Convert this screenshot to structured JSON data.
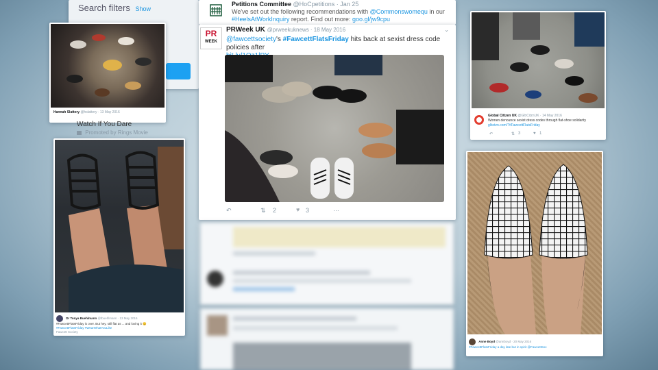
{
  "search_filters": {
    "label": "Search filters",
    "show": "Show"
  },
  "petitions_tweet": {
    "author": "Petitions Committee",
    "handle": "@HoCpetitions · Jan 25",
    "text_1": "We've set out the following recommendations with",
    "mention": "@Commonswomequ",
    "text_2": "in our",
    "hashtag": "#HeelsAtWorkInquiry",
    "text_3": "report. Find out more:",
    "link": "goo.gl/jw9cpu"
  },
  "prweek_tweet": {
    "author": "PRWeek UK",
    "handle": "@prweekuknews · 18 May 2016",
    "logo_line1": "PR",
    "logo_line2": "WEEK",
    "mention": "@fawcettsociety",
    "mention_suffix": "'s",
    "hashtag": "#FawcettFlatsFriday",
    "text": "hits back at sexist dress code policies after",
    "link": "bit.ly/1Oz1lPY",
    "retweets": "2",
    "likes": "3"
  },
  "promoted": {
    "title": "Watch If You Dare",
    "label": "Promoted by Rings Movie"
  },
  "global_citizen_tweet": {
    "author": "Global Citizen UK",
    "handle": "@GlbCitznUK · 14 May 2016",
    "text": "Women denounce sexist dress codes through flat-shoe solidarity",
    "link": "glbctzn.com/?#FawcettFlatsFriday",
    "retweets": "3",
    "likes": "1"
  },
  "tonya_tweet": {
    "author": "Dr Tonya Buehlmann",
    "handle": "@tbuehlmann · 13 May 2016",
    "text": "#FawcettFlatsFriday is over. But hey, still flat as ... and loving it 😊",
    "tags": "#FawcettFlatsFriday #WearWhatYouLike",
    "meta": "Fawcett Society"
  },
  "anne_tweet": {
    "author": "Anne Boyd",
    "handle": "@annboyd · 20 May 2016",
    "text": "#FawcettFlatsFriday a day late but in spirit @FawcettSoc"
  },
  "small_tweet_top_left": {
    "author": "Hannah Slattery",
    "handle": "@hslattery · 13 May 2016"
  },
  "colors": {
    "twitter_blue": "#1b95e0",
    "prweek_red": "#c8102e",
    "global_citizen_red": "#e33d2f"
  }
}
